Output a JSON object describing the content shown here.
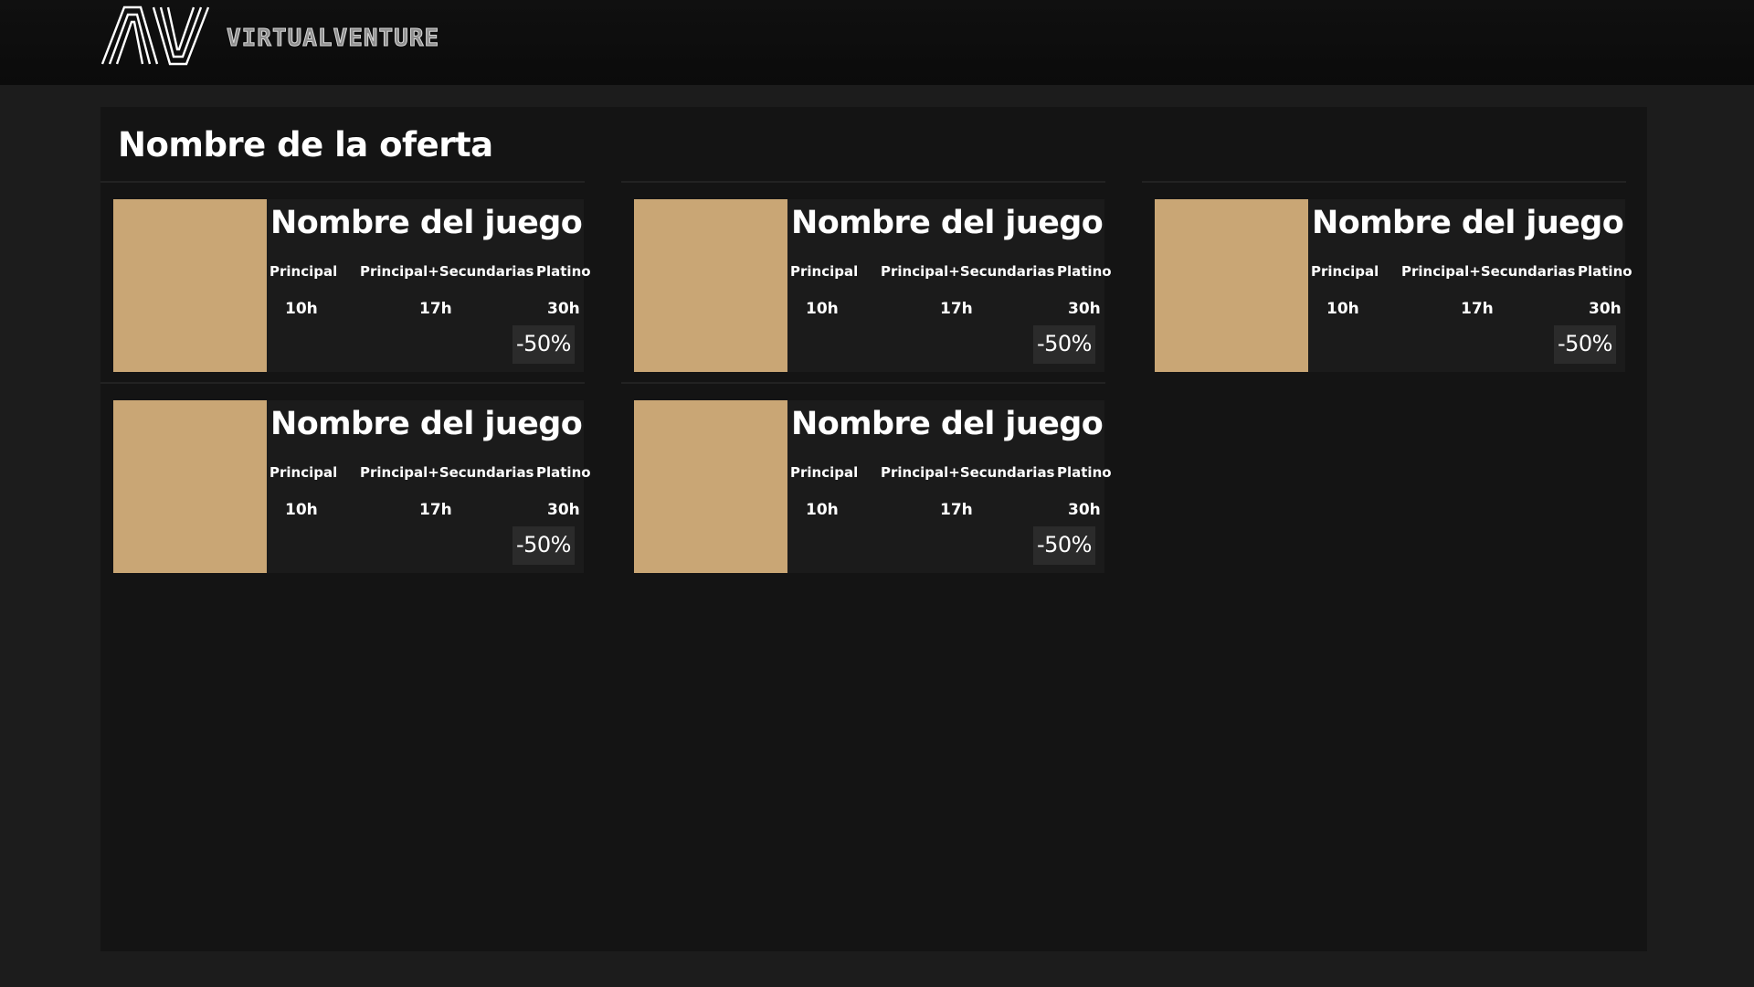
{
  "header": {
    "brand": "VIRTUALVENTURE",
    "logo_icon": "av-logo-icon"
  },
  "offer": {
    "title": "Nombre de la oferta"
  },
  "games": [
    {
      "name": "Nombre del juego",
      "labels": {
        "main": "Principal",
        "secondary": "Principal+Secundarias",
        "platinum": "Platino"
      },
      "times": {
        "main": "10h",
        "secondary": "17h",
        "platinum": "30h"
      },
      "discount": "-50%"
    },
    {
      "name": "Nombre del juego",
      "labels": {
        "main": "Principal",
        "secondary": "Principal+Secundarias",
        "platinum": "Platino"
      },
      "times": {
        "main": "10h",
        "secondary": "17h",
        "platinum": "30h"
      },
      "discount": "-50%"
    },
    {
      "name": "Nombre del juego",
      "labels": {
        "main": "Principal",
        "secondary": "Principal+Secundarias",
        "platinum": "Platino"
      },
      "times": {
        "main": "10h",
        "secondary": "17h",
        "platinum": "30h"
      },
      "discount": "-50%"
    },
    {
      "name": "Nombre del juego",
      "labels": {
        "main": "Principal",
        "secondary": "Principal+Secundarias",
        "platinum": "Platino"
      },
      "times": {
        "main": "10h",
        "secondary": "17h",
        "platinum": "30h"
      },
      "discount": "-50%"
    },
    {
      "name": "Nombre del juego",
      "labels": {
        "main": "Principal",
        "secondary": "Principal+Secundarias",
        "platinum": "Platino"
      },
      "times": {
        "main": "10h",
        "secondary": "17h",
        "platinum": "30h"
      },
      "discount": "-50%"
    }
  ],
  "colors": {
    "background": "#1c1c1c",
    "panel": "#141414",
    "card": "#1b1b1b",
    "cover_placeholder": "#c9a675",
    "discount_badge": "#2b2b2b"
  }
}
